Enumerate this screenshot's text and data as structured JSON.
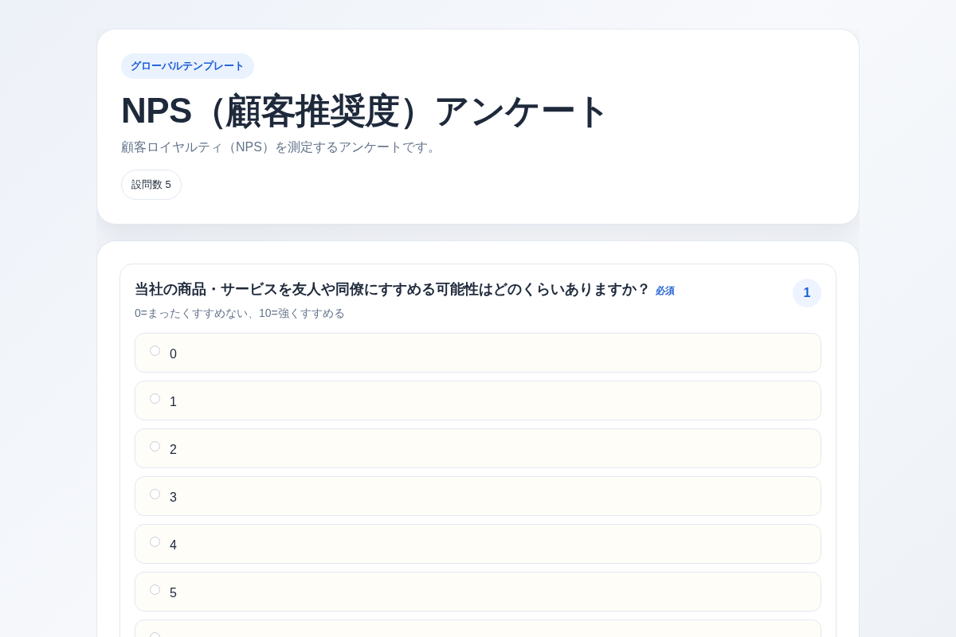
{
  "header": {
    "badge": "グローバルテンプレート",
    "title": "NPS（顧客推奨度）アンケート",
    "description": "顧客ロイヤルティ（NPS）を測定するアンケートです。",
    "question_count": "設問数 5"
  },
  "questions": [
    {
      "number": "1",
      "text": "当社の商品・サービスを友人や同僚にすすめる可能性はどのくらいありますか？",
      "required_label": "必須",
      "help": "0=まったくすすめない、10=強くすすめる",
      "options": [
        {
          "label": "0",
          "selected": false
        },
        {
          "label": "1",
          "selected": false
        },
        {
          "label": "2",
          "selected": false
        },
        {
          "label": "3",
          "selected": false
        },
        {
          "label": "4",
          "selected": false
        },
        {
          "label": "5",
          "selected": false
        },
        {
          "selected": false
        }
      ]
    }
  ]
}
